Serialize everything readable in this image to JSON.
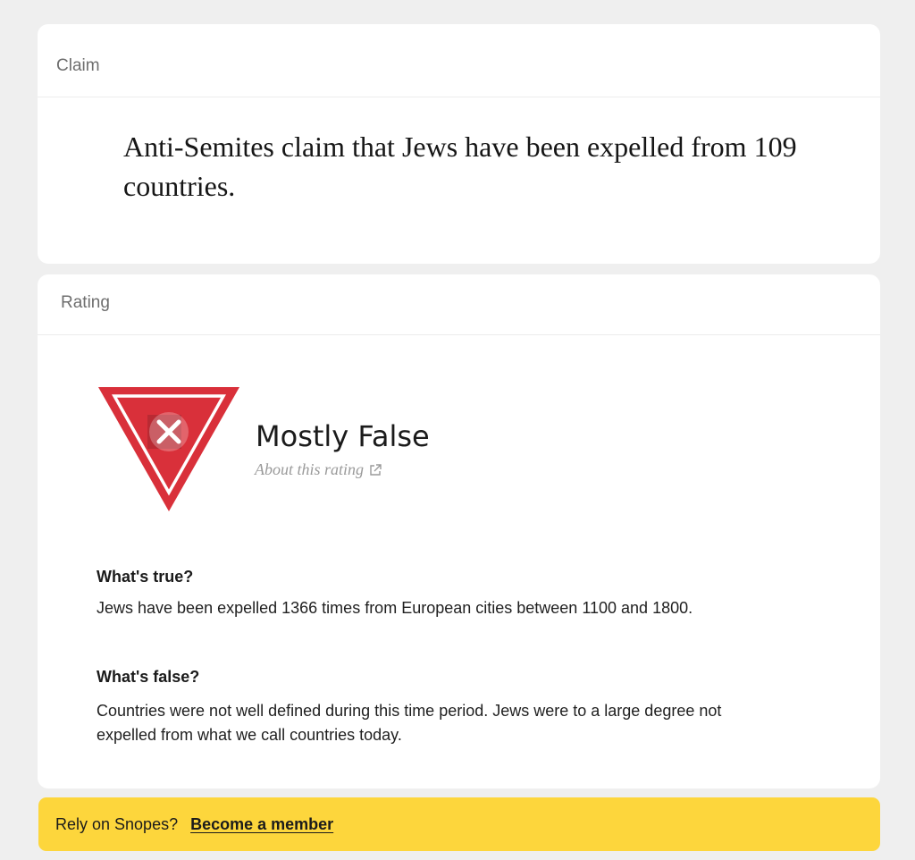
{
  "claim": {
    "label": "Claim",
    "text": "Anti-Semites claim that Jews have been expelled from 109 countries."
  },
  "rating": {
    "label": "Rating",
    "title": "Mostly False",
    "about_link": "About this rating",
    "badge_icon": "mostly-false-icon",
    "badge_color": "#d9303a",
    "whats_true": {
      "heading": "What's true?",
      "body": "Jews have been expelled 1366 times from European cities between 1100 and 1800."
    },
    "whats_false": {
      "heading": "What's false?",
      "body": "Countries were not well defined  during this time period. Jews were to a large degree not expelled from what we call countries today."
    }
  },
  "membership": {
    "prompt": "Rely on Snopes?",
    "link": "Become a member",
    "bar_color": "#fdd63c"
  }
}
